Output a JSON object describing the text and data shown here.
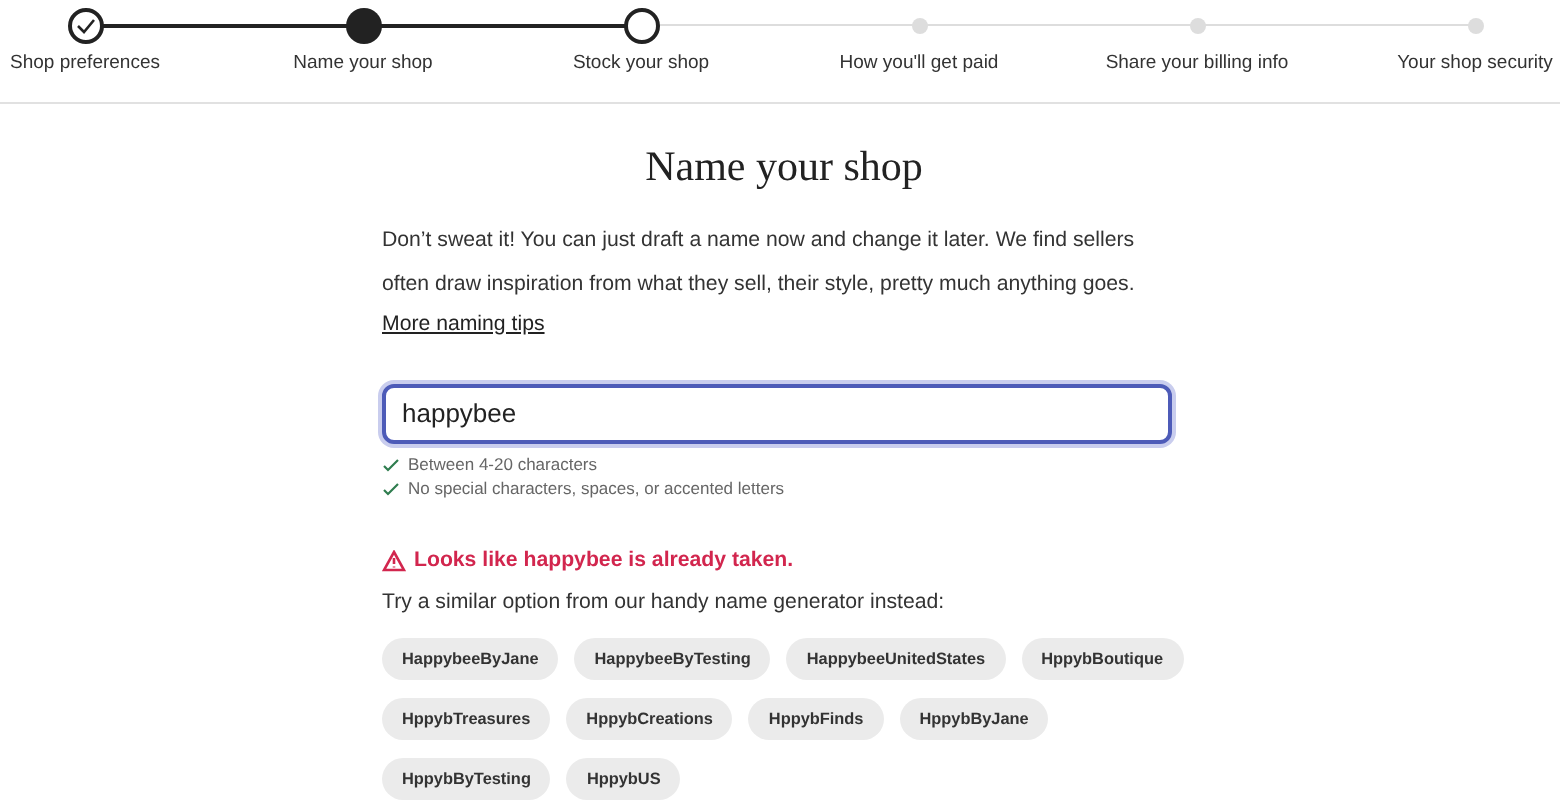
{
  "steps": [
    {
      "label": "Shop preferences",
      "kind": "done"
    },
    {
      "label": "Name your shop",
      "kind": "current"
    },
    {
      "label": "Stock your shop",
      "kind": "next"
    },
    {
      "label": "How you'll get paid",
      "kind": "upcoming"
    },
    {
      "label": "Share your billing info",
      "kind": "upcoming"
    },
    {
      "label": "Your shop security",
      "kind": "upcoming"
    }
  ],
  "title": "Name your shop",
  "intro": "Don’t sweat it! You can just draft a name now and change it later. We find sellers often draw inspiration from what they sell, their style, pretty much anything goes.",
  "tips_link": "More naming tips",
  "name_field": {
    "value": "happybee",
    "focused": true
  },
  "rules": [
    {
      "text": "Between 4-20 characters",
      "met": true
    },
    {
      "text": "No special characters, spaces, or accented letters",
      "met": true
    }
  ],
  "error": "Looks like happybee is already taken.",
  "suggestion_prompt": "Try a similar option from our handy name generator instead:",
  "suggestions": [
    "HappybeeByJane",
    "HappybeeByTesting",
    "HappybeeUnitedStates",
    "HppybBoutique",
    "HppybTreasures",
    "HppybCreations",
    "HppybFinds",
    "HppybByJane",
    "HppybByTesting",
    "HppybUS"
  ]
}
